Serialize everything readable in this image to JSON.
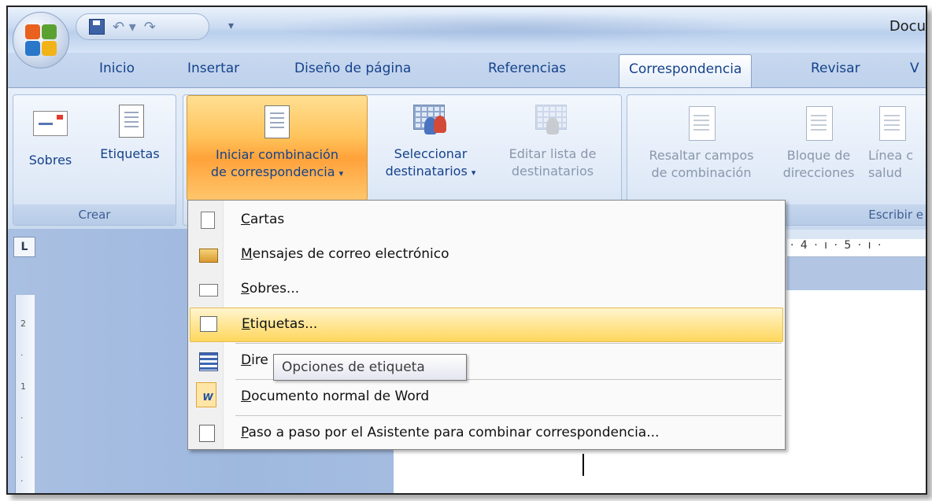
{
  "window": {
    "title": "Docu"
  },
  "quick_access": {
    "save": "save-icon",
    "undo": "undo-icon",
    "redo": "redo-icon",
    "customize": "▾"
  },
  "tabs": [
    {
      "label": "Inicio",
      "active": false
    },
    {
      "label": "Insertar",
      "active": false
    },
    {
      "label": "Diseño de página",
      "active": false
    },
    {
      "label": "Referencias",
      "active": false
    },
    {
      "label": "Correspondencia",
      "active": true
    },
    {
      "label": "Revisar",
      "active": false
    },
    {
      "label": "V",
      "active": false
    }
  ],
  "ribbon": {
    "crear": {
      "label": "Crear",
      "sobres": "Sobres",
      "etiquetas": "Etiquetas"
    },
    "iniciar": {
      "iniciar_line1": "Iniciar combinación",
      "iniciar_line2": "de correspondencia",
      "seleccionar_line1": "Seleccionar",
      "seleccionar_line2": "destinatarios",
      "editar_line1": "Editar lista de",
      "editar_line2": "destinatarios"
    },
    "escribir": {
      "label": "Escribir e",
      "resaltar_line1": "Resaltar campos",
      "resaltar_line2": "de combinación",
      "bloque_line1": "Bloque de",
      "bloque_line2": "direcciones",
      "linea_line1": "Línea c",
      "linea_line2": "salud"
    }
  },
  "ruler": {
    "left_corner": "L",
    "h_marks": "· 4 · ı · 5 · ı ·"
  },
  "menu": {
    "items": [
      {
        "key": "C",
        "rest": "artas",
        "icon": "document-icon"
      },
      {
        "key": "M",
        "rest": "ensajes de correo electrónico",
        "icon": "email-icon"
      },
      {
        "key": "S",
        "rest": "obres...",
        "icon": "envelope-icon"
      },
      {
        "key": "E",
        "rest": "tiquetas...",
        "icon": "labels-icon",
        "highlighted": true
      },
      {
        "key": "D",
        "rest": "ire",
        "icon": "directory-icon"
      },
      {
        "key": "D",
        "rest": "ocumento normal de Word",
        "icon": "word-doc-icon"
      },
      {
        "key": "P",
        "rest": "aso a paso por el Asistente para combinar correspondencia...",
        "icon": "wizard-icon"
      }
    ]
  },
  "tooltip": {
    "text": "Opciones de etiqueta"
  },
  "colors": {
    "accent": "#ffc35a",
    "ribbon_text": "#15428b",
    "menu_hover": "#ffe694"
  }
}
